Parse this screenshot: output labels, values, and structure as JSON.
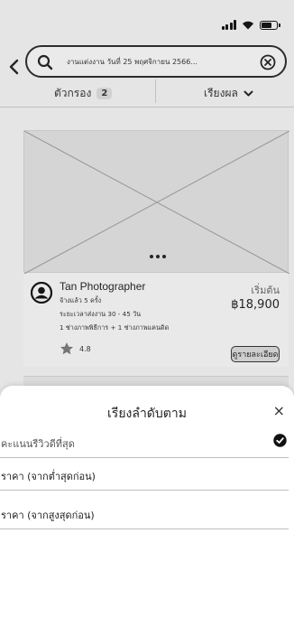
{
  "search": {
    "query": "งานแต่งงาน  วันที่ 25 พฤศจิกายน 2566..."
  },
  "toolbar": {
    "filter_label": "ตัวกรอง",
    "filter_count": "2",
    "sort_label": "เรียงผล"
  },
  "card": {
    "name": "Tan Photographer",
    "hired": "จ้างแล้ว 5 ครั้ง",
    "delivery": "ระยะเวลาส่งงาน 30 - 45 วัน",
    "crew": "1 ช่างภาพพิธีการ + 1 ช่างภาพแคนดิด",
    "rating": "4.8",
    "price_prefix": "เริ่มต้น",
    "price": "฿18,900",
    "details_label": "ดูรายละเอียด"
  },
  "sheet": {
    "title": "เรียงลำดับตาม",
    "close": "×",
    "options": [
      {
        "label": "คะแนนรีวิวดีที่สุด",
        "selected": true
      },
      {
        "label": "ราคา (จากต่ำสุดก่อน)",
        "selected": false
      },
      {
        "label": "ราคา (จากสูงสุดก่อน)",
        "selected": false
      }
    ]
  },
  "icons": {
    "back": "chevron-left-icon",
    "search": "search-icon",
    "clear": "clear-circle-icon",
    "sort_chevron": "chevron-down-icon",
    "avatar": "user-avatar-icon",
    "star": "star-icon",
    "check": "check-circle-icon"
  }
}
